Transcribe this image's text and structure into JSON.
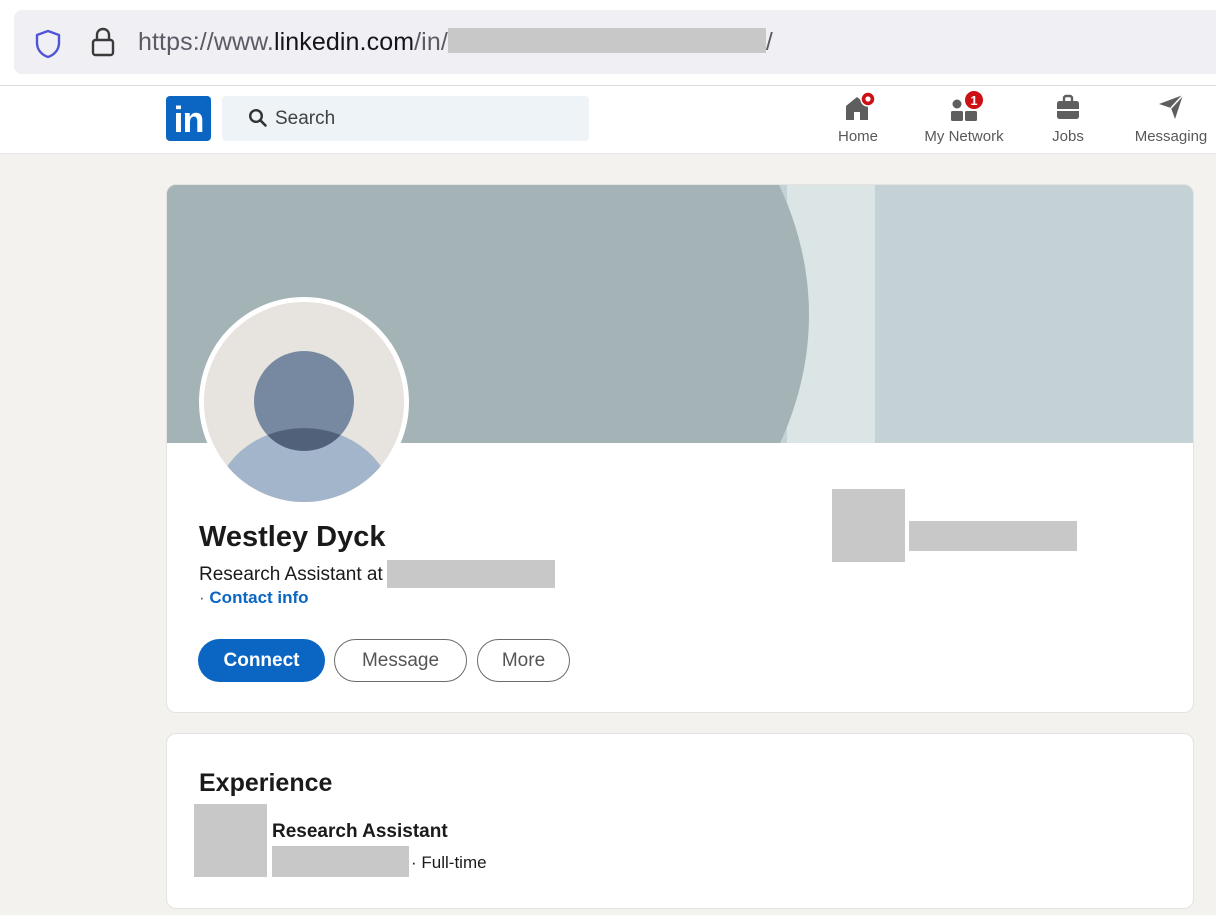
{
  "browser": {
    "url_prefix": "https://www.",
    "url_domain": "linkedin.com",
    "url_path": "/in/",
    "url_suffix": "/"
  },
  "nav": {
    "logo_text": "in",
    "search_placeholder": "Search",
    "items": [
      {
        "label": "Home",
        "icon": "home-icon",
        "badge": ""
      },
      {
        "label": "My Network",
        "icon": "network-icon",
        "badge": "1"
      },
      {
        "label": "Jobs",
        "icon": "briefcase-icon",
        "badge": ""
      },
      {
        "label": "Messaging",
        "icon": "send-icon",
        "badge": ""
      }
    ]
  },
  "profile": {
    "name": "Westley Dyck",
    "headline_prefix": "Research Assistant at",
    "contact_separator": "·",
    "contact_link": "Contact info",
    "buttons": {
      "connect": "Connect",
      "message": "Message",
      "more": "More"
    }
  },
  "experience": {
    "title": "Experience",
    "role": "Research Assistant",
    "employment_type": "· Full-time"
  },
  "colors": {
    "brand": "#0a66c2",
    "badge": "#cc1016",
    "page_background": "#f4f2ee",
    "redaction": "#c8c8c8"
  }
}
